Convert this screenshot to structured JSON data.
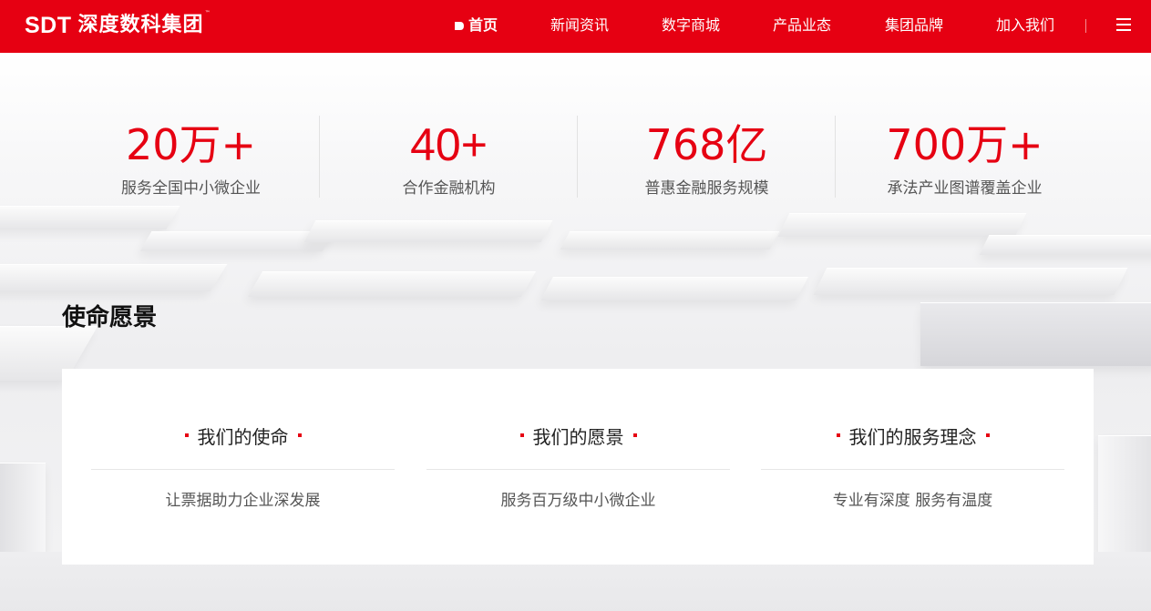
{
  "header": {
    "logo_en": "SDT",
    "logo_cn": "深度数科集团",
    "logo_tm": "™",
    "brand_color": "#e60012",
    "nav": [
      {
        "label": "首页",
        "active": true
      },
      {
        "label": "新闻资讯"
      },
      {
        "label": "数字商城"
      },
      {
        "label": "产品业态"
      },
      {
        "label": "集团品牌"
      },
      {
        "label": "加入我们"
      }
    ],
    "menu_icon": "hamburger-menu-icon"
  },
  "stats": [
    {
      "value": "20万+",
      "label": "服务全国中小微企业"
    },
    {
      "value": "40+",
      "label": "合作金融机构"
    },
    {
      "value": "768亿",
      "label": "普惠金融服务规模"
    },
    {
      "value": "700万+",
      "label": "承法产业图谱覆盖企业"
    }
  ],
  "mission": {
    "title": "使命愿景",
    "columns": [
      {
        "heading": "我们的使命",
        "text": "让票据助力企业深发展"
      },
      {
        "heading": "我们的愿景",
        "text": "服务百万级中小微企业"
      },
      {
        "heading": "我们的服务理念",
        "text": "专业有深度 服务有温度"
      }
    ]
  }
}
